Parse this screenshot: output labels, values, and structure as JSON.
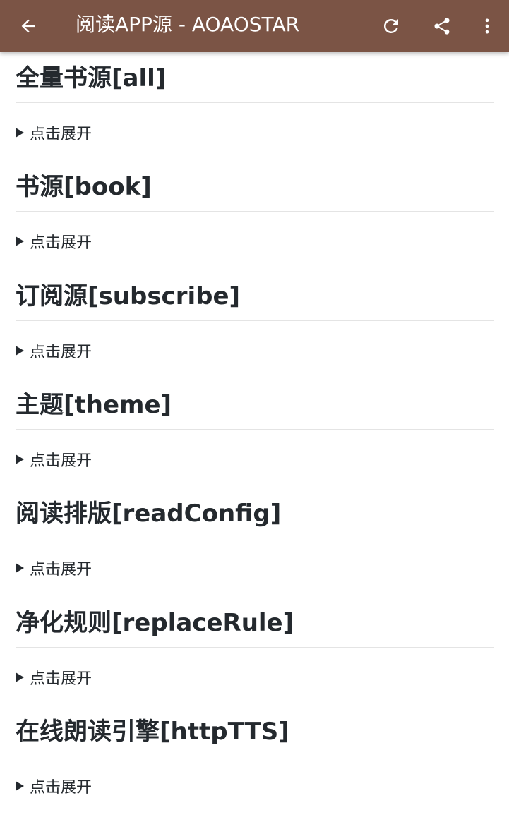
{
  "appbar": {
    "title": "阅读APP源 - AOAOSTAR",
    "color": "#7b5445",
    "icons": {
      "back": "arrow-left-icon",
      "refresh": "refresh-icon",
      "share": "share-icon",
      "more": "more-vert-icon"
    }
  },
  "sections": [
    {
      "heading": "全量书源[all]",
      "summary": "点击展开"
    },
    {
      "heading": "书源[book]",
      "summary": "点击展开"
    },
    {
      "heading": "订阅源[subscribe]",
      "summary": "点击展开"
    },
    {
      "heading": "主题[theme]",
      "summary": "点击展开"
    },
    {
      "heading": "阅读排版[readConfig]",
      "summary": "点击展开"
    },
    {
      "heading": "净化规则[replaceRule]",
      "summary": "点击展开"
    },
    {
      "heading": "在线朗读引擎[httpTTS]",
      "summary": "点击展开"
    }
  ]
}
